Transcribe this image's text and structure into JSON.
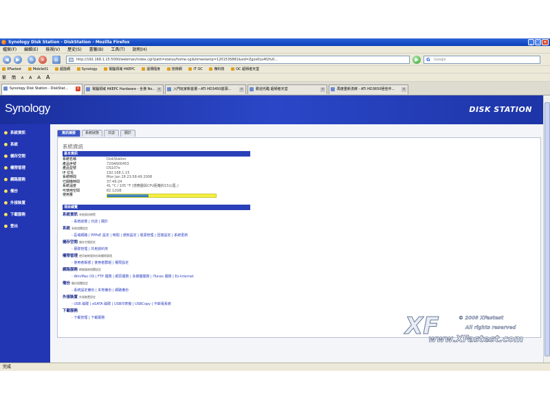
{
  "window": {
    "title": "Synology Disk Station - DiskStation - Mozilla Firefox",
    "min": "_",
    "max": "□",
    "close": "×"
  },
  "menu": [
    "檔案(F)",
    "編輯(E)",
    "檢視(V)",
    "歷史(S)",
    "書籤(B)",
    "工具(T)",
    "說明(H)"
  ],
  "nav": {
    "url": "http://192.168.1.15:5000/webman/index.cgi?path=status/home.cgi&timestamp=1201535881&sid=Zgzx0Lo4f2fu0...",
    "search_placeholder": "Google",
    "search_glyph": "G",
    "back": "◀",
    "forward": "▶",
    "reload": "↻",
    "stop": "×",
    "home": "⌂",
    "go": "▶"
  },
  "bookmarks": [
    "XFastest",
    "Mobile01",
    "超能網",
    "Synology",
    "電腦領域 HKEPC",
    "遠傳隨身",
    "技術網",
    "IT OC",
    "微科技",
    "OC 超頻者天堂"
  ],
  "toolbar2": [
    "繁",
    "簡",
    "A",
    "A",
    "A",
    "A"
  ],
  "browser_tabs": [
    {
      "label": "Synology Disk Station - DiskStat...",
      "active": true
    },
    {
      "label": "電腦領域 HKEPC Hardware - 全港 No...",
      "active": false
    },
    {
      "label": "入門玩家新首選－ATI HD3450搶頭...",
      "active": false
    },
    {
      "label": "歡迎光臨 超頻者天堂",
      "active": false
    },
    {
      "label": "再度重新洗牌 - ATI HD3650極佳中...",
      "active": false
    }
  ],
  "header": {
    "logo": "Synology",
    "product": "DISK STATION"
  },
  "sidebar": [
    "系統資訊",
    "系統",
    "儲存空間",
    "權限管理",
    "網路服務",
    "備份",
    "外接裝置",
    "下載服務",
    "登出"
  ],
  "page_tabs": [
    "資訊摘要",
    "系統狀態",
    "日誌",
    "關於"
  ],
  "panel": {
    "title": "系統資訊",
    "basic_head": "基本資訊",
    "basic": [
      {
        "k": "系統名稱",
        "v": "DiskStation"
      },
      {
        "k": "產品序號",
        "v": "720AN00453"
      },
      {
        "k": "產品型號",
        "v": "DS107e"
      },
      {
        "k": "IP 位址",
        "v": "192.168.1.15"
      },
      {
        "k": "系統時間",
        "v": "Mon Jan 28 23:58:49 2008"
      },
      {
        "k": "已開機時間",
        "v": "37:49:24"
      },
      {
        "k": "系統溫度",
        "v": "41 °C / 105 °F   (感應器與CPU距離約15公厘。)"
      },
      {
        "k": "可使用空間",
        "v": "82.12GB"
      },
      {
        "k": "使用量",
        "v": ""
      }
    ],
    "usage_fraction": 0.38,
    "items_head": "項目總覽",
    "categories": [
      {
        "name": "系統資訊",
        "desc": "系統資訊總覽",
        "links": "- 系統狀態 | 日誌 | 關於"
      },
      {
        "name": "系統",
        "desc": "系統相關設定",
        "links": "- 區域網路 | PPPoE 設定 | 時間 | 通知設定 | 電源管理 | 回復設定 | 系統更新"
      },
      {
        "name": "儲存空間",
        "desc": "儲存空間設定",
        "links": "- 硬碟管理 | 共用資料夾"
      },
      {
        "name": "權限管理",
        "desc": "使用者帳號與存取權限管理",
        "links": "- 使用者帳號 | 使用者群組 | 權限設定"
      },
      {
        "name": "網路服務",
        "desc": "網路服務相關設定",
        "links": "- Win/Mac OS | FTP 服務 | 網頁服務 | 多媒體服務 | iTunes 服務 | Ez-Internet"
      },
      {
        "name": "備份",
        "desc": "備份相關設定",
        "links": "- 系統設定備份 | 本地備份 | 網路備份"
      },
      {
        "name": "外接裝置",
        "desc": "外接裝置設定",
        "links": "- USB 磁碟 | eSATA 磁碟 | USB印表機 | USBCopy | 不斷電系統"
      },
      {
        "name": "下載服務",
        "desc": "",
        "links": "- 下載管理 | 下載服務"
      }
    ]
  },
  "watermark": {
    "big": "XF",
    "copyright": "© 2008 XFastest",
    "rights": "All rights reserved",
    "url": "www.XFastest.com"
  },
  "status": "完成"
}
